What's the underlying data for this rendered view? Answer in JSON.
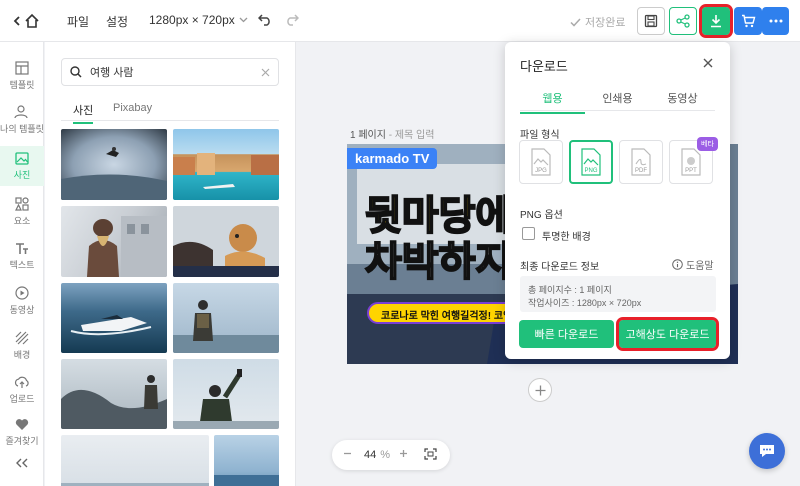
{
  "topbar": {
    "file": "파일",
    "settings": "설정",
    "size": "1280px × 720px",
    "saved": "저장완료"
  },
  "sidebar": {
    "items": [
      {
        "label": "템플릿"
      },
      {
        "label": "나의 템플릿"
      },
      {
        "label": "사진"
      },
      {
        "label": "요소"
      },
      {
        "label": "텍스트"
      },
      {
        "label": "동영상"
      },
      {
        "label": "배경"
      },
      {
        "label": "업로드"
      },
      {
        "label": "즐겨찾기"
      }
    ]
  },
  "panel": {
    "search_value": "여행 사람",
    "tabs": [
      "사진",
      "Pixabay"
    ]
  },
  "canvas": {
    "page_label_num": "1 페이지",
    "page_label_title": "- 제목 입력",
    "badge": "karmado TV",
    "headline1": "뒷마당에",
    "headline2": "차박하지",
    "banner": "코로나로 막힌 여행길걱정! 코엄에서"
  },
  "zoom": {
    "value": "44",
    "unit": "%"
  },
  "download": {
    "title": "다운로드",
    "tabs": [
      "웹용",
      "인쇄용",
      "동영상"
    ],
    "format_label": "파일 형식",
    "formats": [
      "JPG",
      "PNG",
      "PDF",
      "PPT"
    ],
    "beta": "베타",
    "png_options": "PNG 옵션",
    "transparent": "투명한 배경",
    "final_info": "최종 다운로드 정보",
    "help": "도움말",
    "pages": "총 페이지수 : 1 페이지",
    "dims": "작업사이즈 : 1280px × 720px",
    "quick": "빠른 다운로드",
    "hd": "고해상도 다운로드"
  },
  "colors": {
    "accent": "#20c07b",
    "highlight": "#e8212a",
    "blue": "#2f80ed"
  }
}
